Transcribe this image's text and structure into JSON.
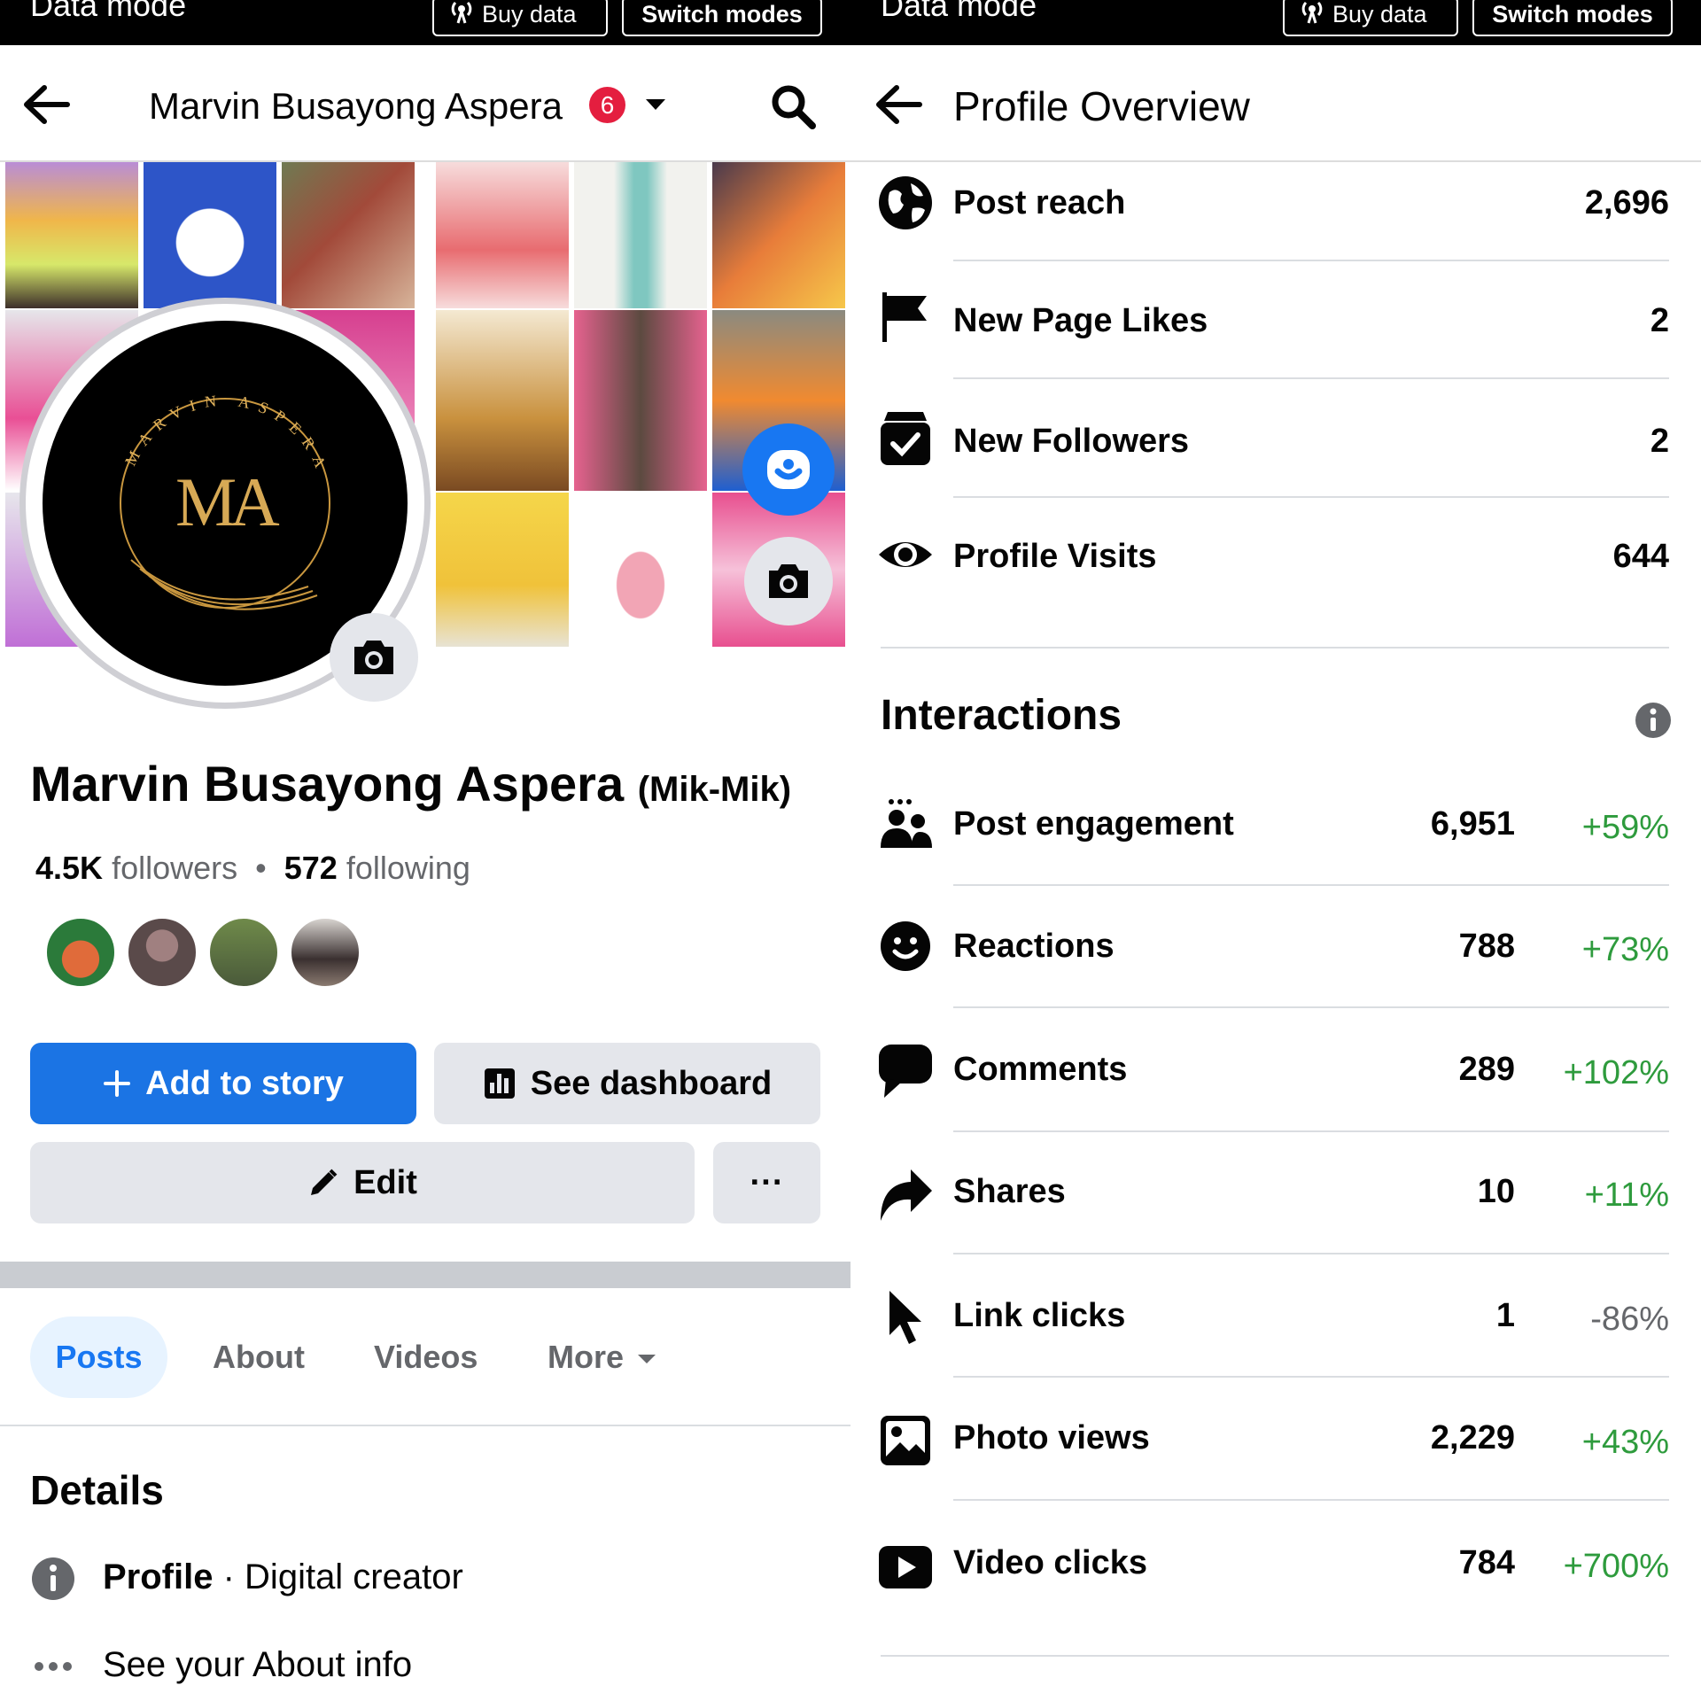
{
  "status_bar": {
    "data_mode_label": "Data mode",
    "buy_data_label": "Buy data",
    "switch_modes_label": "Switch modes"
  },
  "profile_screen": {
    "header": {
      "title": "Marvin Busayong Aspera",
      "notification_count": "6"
    },
    "avatar": {
      "ring_text": "MARVIN ASPERA",
      "monogram": "MA"
    },
    "name": "Marvin Busayong Aspera",
    "nickname": "(Mik-Mik)",
    "followers_count": "4.5K",
    "followers_label": "followers",
    "following_count": "572",
    "following_label": "following",
    "friend_avatar_colors": [
      "#c44a2e",
      "#6b5b5b",
      "#5c7a3a",
      "#8a7a70"
    ],
    "buttons": {
      "add_to_story": "Add to story",
      "see_dashboard": "See dashboard",
      "edit": "Edit",
      "more": "···"
    },
    "tabs": [
      "Posts",
      "About",
      "Videos",
      "More"
    ],
    "details": {
      "title": "Details",
      "profile_label": "Profile",
      "profile_value": "· Digital creator",
      "about_link": "See your About info"
    },
    "colors": {
      "accent": "#1b74e4",
      "notification": "#e41e3f"
    }
  },
  "overview_screen": {
    "header": {
      "title": "Profile Overview"
    },
    "metrics": [
      {
        "icon": "globe-icon",
        "label": "Post reach",
        "value": "2,696"
      },
      {
        "icon": "flag-icon",
        "label": "New Page Likes",
        "value": "2"
      },
      {
        "icon": "follow-check-icon",
        "label": "New Followers",
        "value": "2"
      },
      {
        "icon": "eye-icon",
        "label": "Profile Visits",
        "value": "644"
      }
    ],
    "interactions_title": "Interactions",
    "interactions": [
      {
        "icon": "people-icon",
        "label": "Post engagement",
        "value": "6,951",
        "change": "+59%",
        "trend": "up"
      },
      {
        "icon": "smiley-icon",
        "label": "Reactions",
        "value": "788",
        "change": "+73%",
        "trend": "up"
      },
      {
        "icon": "comment-icon",
        "label": "Comments",
        "value": "289",
        "change": "+102%",
        "trend": "up"
      },
      {
        "icon": "share-icon",
        "label": "Shares",
        "value": "10",
        "change": "+11%",
        "trend": "up"
      },
      {
        "icon": "cursor-icon",
        "label": "Link clicks",
        "value": "1",
        "change": "-86%",
        "trend": "down"
      },
      {
        "icon": "photo-icon",
        "label": "Photo views",
        "value": "2,229",
        "change": "+43%",
        "trend": "up"
      },
      {
        "icon": "play-icon",
        "label": "Video clicks",
        "value": "784",
        "change": "+700%",
        "trend": "up"
      }
    ],
    "colors": {
      "positive": "#2e9b3d",
      "negative": "#65676b"
    }
  }
}
